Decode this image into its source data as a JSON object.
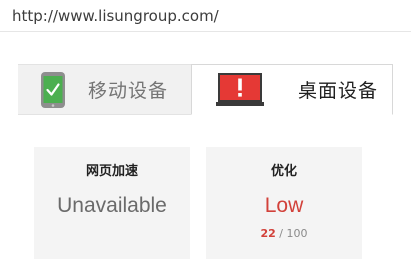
{
  "url_bar": {
    "url": "http://www.lisungroup.com/"
  },
  "tabs": [
    {
      "label": "移动设备",
      "icon": "mobile-phone-check-icon",
      "active": false
    },
    {
      "label": "桌面设备",
      "icon": "desktop-warning-icon",
      "active": true
    }
  ],
  "cards": {
    "speed": {
      "title": "网页加速",
      "value": "Unavailable"
    },
    "optimization": {
      "title": "优化",
      "value": "Low",
      "score": "22",
      "score_max": "/ 100"
    }
  },
  "colors": {
    "tab_background": "#f1f1f1",
    "card_background": "#f4f4f4",
    "low_red": "#d2413a",
    "mobile_green": "#4caf50",
    "desktop_red": "#e53935"
  }
}
